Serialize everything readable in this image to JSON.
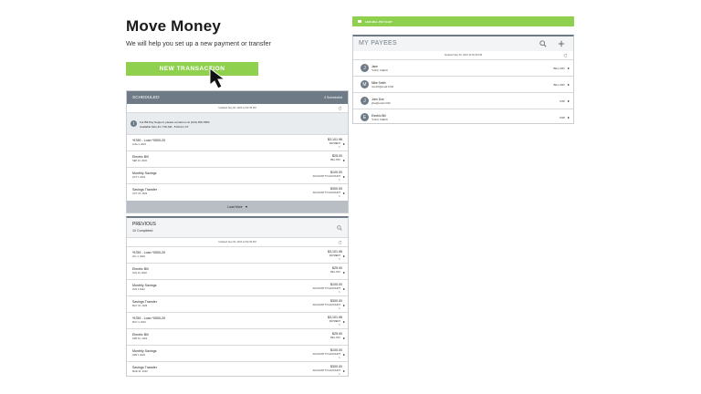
{
  "hero": {
    "title": "Move Money",
    "subtitle": "We will help you set up a new payment or transfer"
  },
  "new_transaction_label": "NEW TRANSACTION",
  "top_banner": {
    "label": "LIVE BILL PAY CHAT"
  },
  "payees": {
    "title": "MY PAYEES",
    "updated": "Updated Sep 30, 2024 12:52:39 PM",
    "items": [
      {
        "initial": "J",
        "name": "Jane",
        "account": "*1234 | CHECK",
        "method": "BILL PAY"
      },
      {
        "initial": "M",
        "name": "Mike Smith",
        "account": "msmith@email.COM",
        "method": "BILL PAY"
      },
      {
        "initial": "J",
        "name": "John Doe",
        "account": "jdoe@email.COM",
        "method": "P2P"
      },
      {
        "initial": "E",
        "name": "Electric Bill",
        "account": "*1234 | CHECK",
        "method": "P2P"
      }
    ]
  },
  "scheduled": {
    "title": "SCHEDULED",
    "count": "4 Scheduled",
    "updated": "Updated Sep 30, 2024 12:52:39 PM",
    "notice_line1": "For Bill Pay Support, please contact us at (123) 456-7890",
    "notice_line2": "Available Mon-Fri 7:00 AM - 5:00 Am CT",
    "items": [
      {
        "name": "*6789 - Loan *0500-20",
        "date": "AUG 4, 2022",
        "amount": "$3,101.96",
        "type": "PAYMENT",
        "edit": "✎"
      },
      {
        "name": "Electric Bill",
        "date": "SEP 10, 2022",
        "amount": "$25.00",
        "type": "BILL PAY",
        "edit": ""
      },
      {
        "name": "Monthly Savings",
        "date": "OCT 1 2022",
        "amount": "$100.00",
        "type": "ACCOUNT TO ACCOUNT",
        "edit": "✎"
      },
      {
        "name": "Savings Transfer",
        "date": "OCT 31, 2022",
        "amount": "$300.00",
        "type": "ACCOUNT TO ACCOUNT",
        "edit": "✎"
      }
    ],
    "load_more": "Load More"
  },
  "previous": {
    "title": "PREVIOUS",
    "count": "10 Completed",
    "updated": "Updated Sep 30, 2024 12:52:39 PM",
    "items": [
      {
        "name": "*6789 - Loan *0500-20",
        "date": "JUL 4, 2022",
        "amount": "$3,101.96",
        "type": "PAYMENT",
        "edit": "✎"
      },
      {
        "name": "Electric Bill",
        "date": "JUN 10, 2022",
        "amount": "$25.00",
        "type": "BILL PAY",
        "edit": ""
      },
      {
        "name": "Monthly Savings",
        "date": "JUN 1 2022",
        "amount": "$100.00",
        "type": "ACCOUNT TO ACCOUNT",
        "edit": "✎"
      },
      {
        "name": "Savings Transfer",
        "date": "MAY 31, 2022",
        "amount": "$300.00",
        "type": "ACCOUNT TO ACCOUNT",
        "edit": "✎"
      },
      {
        "name": "*6789 - Loan *0500-20",
        "date": "MAY 4, 2022",
        "amount": "$3,101.96",
        "type": "PAYMENT",
        "edit": "✎"
      },
      {
        "name": "Electric Bill",
        "date": "APR 10, 2022",
        "amount": "$25.00",
        "type": "BILL PAY",
        "edit": ""
      },
      {
        "name": "Monthly Savings",
        "date": "APR 1 2022",
        "amount": "$100.00",
        "type": "ACCOUNT TO ACCOUNT",
        "edit": "✎"
      },
      {
        "name": "Savings Transfer",
        "date": "MAR 31, 2022",
        "amount": "$300.00",
        "type": "ACCOUNT TO ACCOUNT",
        "edit": "✎"
      }
    ]
  },
  "colors": {
    "accent_green": "#8fd14f",
    "header_gray": "#6e7b87",
    "panel_border": "#c9ced3"
  },
  "icons": {
    "search": "search-icon",
    "add": "plus-icon",
    "refresh": "refresh-icon",
    "info": "info-icon",
    "chat": "chat-icon",
    "cursor": "cursor-icon"
  }
}
